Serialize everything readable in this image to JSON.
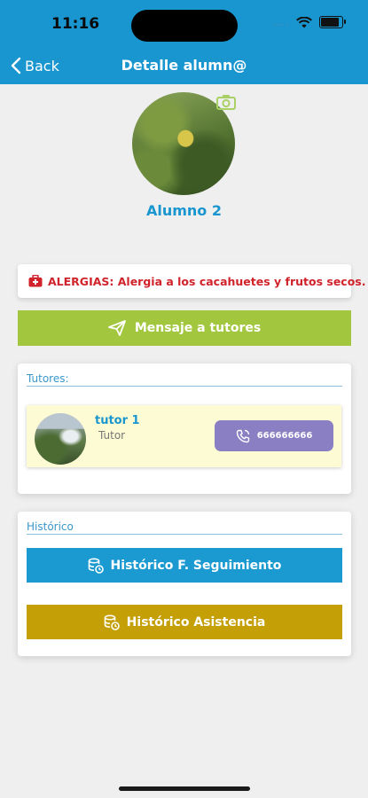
{
  "status_bar": {
    "time": "11:16",
    "signal_dots": "....",
    "battery_level": 0.85
  },
  "nav": {
    "back_label": "Back",
    "title": "Detalle alumn@"
  },
  "student": {
    "name": "Alumno 2"
  },
  "allergy": {
    "text": "ALERGIAS: Alergia a los cacahuetes y frutos secos."
  },
  "message_button": {
    "label": "Mensaje a tutores"
  },
  "tutors_card": {
    "title": "Tutores:",
    "tutors": [
      {
        "name": "tutor 1",
        "role": "Tutor",
        "phone": "666666666"
      }
    ]
  },
  "history_card": {
    "title": "Histórico",
    "buttons": [
      {
        "label": "Histórico F. Seguimiento",
        "color": "#1b9ad2"
      },
      {
        "label": "Histórico Asistencia",
        "color": "#c49f06"
      }
    ]
  },
  "colors": {
    "header": "#1996cf",
    "allergy_text": "#d0232b",
    "message_button": "#a2c73e",
    "call_button": "#8b7fc4"
  }
}
